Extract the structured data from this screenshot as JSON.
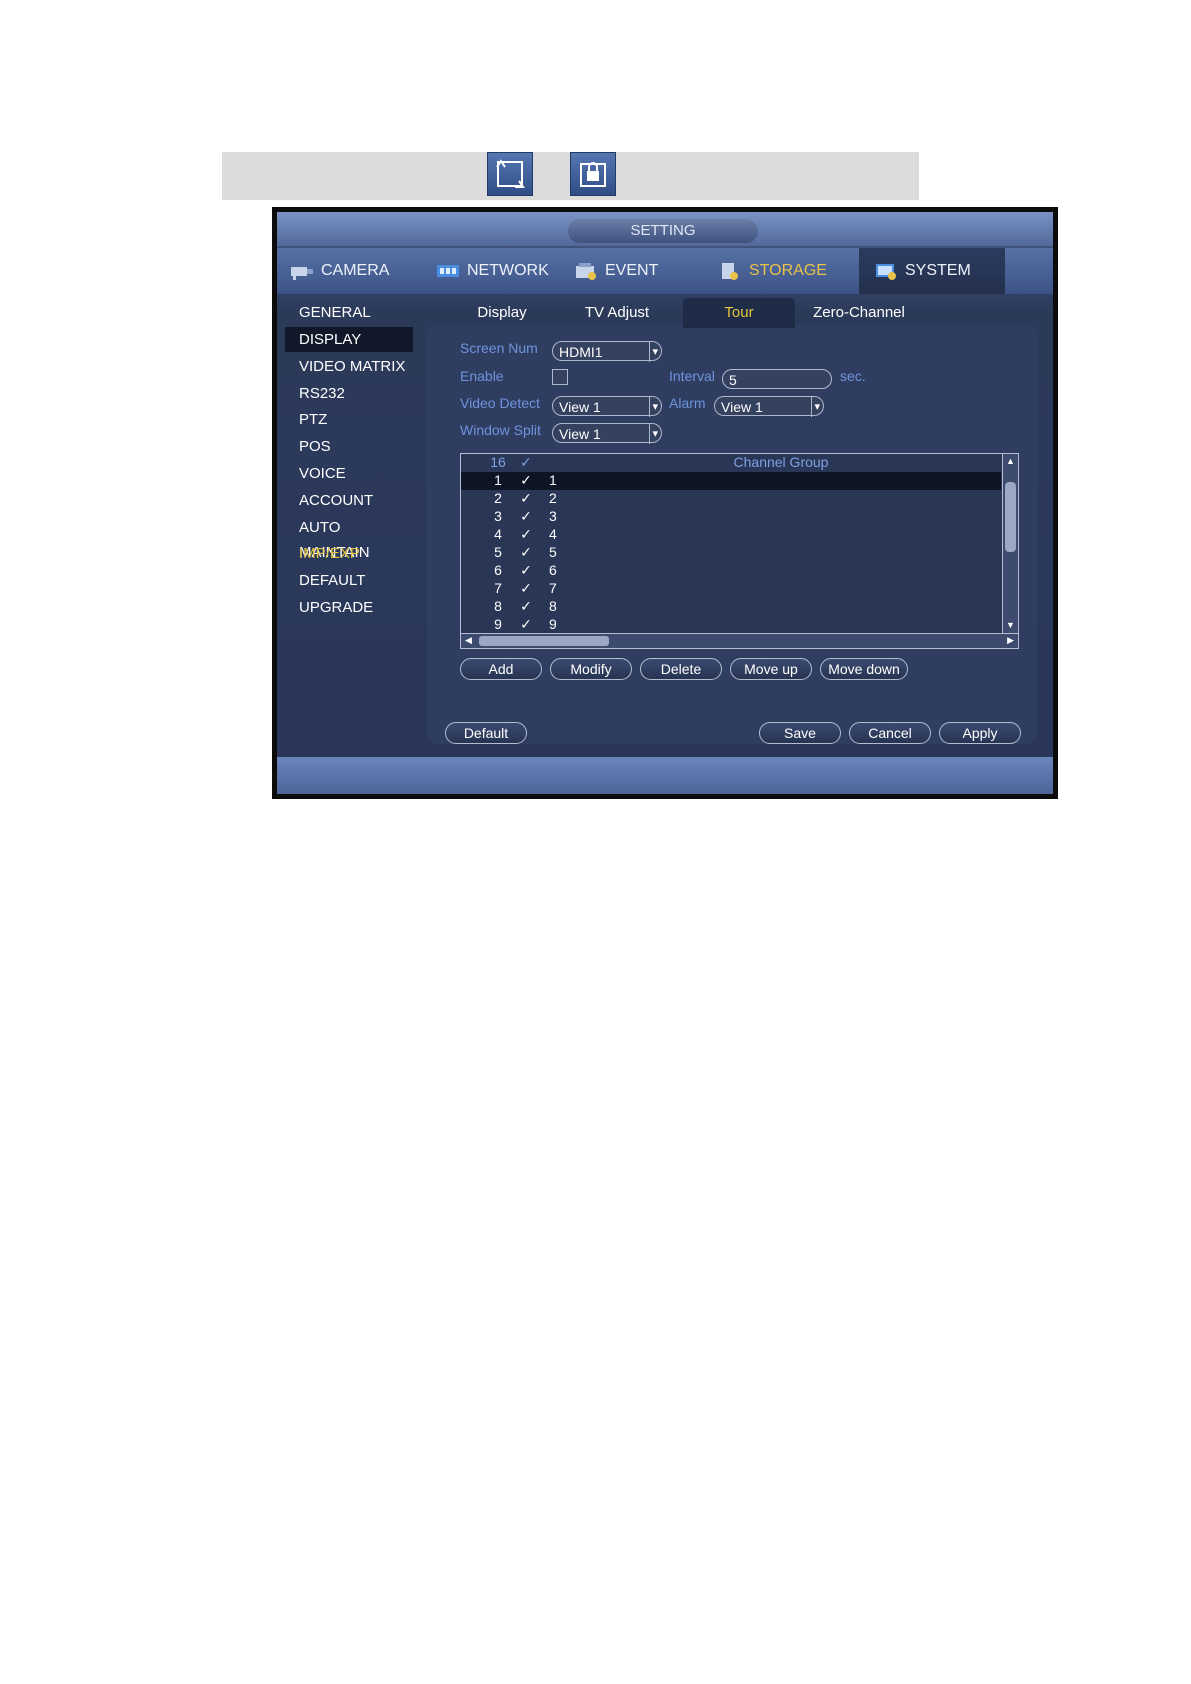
{
  "window": {
    "title": "SETTING"
  },
  "top_tabs": [
    {
      "label": "CAMERA",
      "icon": "camera-icon"
    },
    {
      "label": "NETWORK",
      "icon": "network-icon"
    },
    {
      "label": "EVENT",
      "icon": "event-icon"
    },
    {
      "label": "STORAGE",
      "icon": "storage-icon"
    },
    {
      "label": "SYSTEM",
      "icon": "system-icon"
    }
  ],
  "sidebar": {
    "items": [
      {
        "label": "GENERAL"
      },
      {
        "label": "DISPLAY"
      },
      {
        "label": "VIDEO MATRIX"
      },
      {
        "label": "RS232"
      },
      {
        "label": "PTZ"
      },
      {
        "label": "POS"
      },
      {
        "label": "VOICE"
      },
      {
        "label": "ACCOUNT"
      },
      {
        "label": "AUTO MAINTAIN"
      },
      {
        "label": "IMP/EXP"
      },
      {
        "label": "DEFAULT"
      },
      {
        "label": "UPGRADE"
      }
    ]
  },
  "sub_tabs": [
    {
      "label": "Display"
    },
    {
      "label": "TV Adjust"
    },
    {
      "label": "Tour"
    },
    {
      "label": "Zero-Channel"
    }
  ],
  "form": {
    "screen_num_label": "Screen Num",
    "screen_num_value": "HDMI1",
    "enable_label": "Enable",
    "interval_label": "Interval",
    "interval_value": "5",
    "interval_unit": "sec.",
    "video_detect_label": "Video Detect",
    "video_detect_value": "View 1",
    "alarm_label": "Alarm",
    "alarm_value": "View 1",
    "window_split_label": "Window Split",
    "window_split_value": "View 1"
  },
  "table": {
    "header": {
      "count": "16",
      "check": "✓",
      "group": "Channel Group"
    },
    "rows": [
      {
        "num": "1",
        "check": "✓",
        "group": "1"
      },
      {
        "num": "2",
        "check": "✓",
        "group": "2"
      },
      {
        "num": "3",
        "check": "✓",
        "group": "3"
      },
      {
        "num": "4",
        "check": "✓",
        "group": "4"
      },
      {
        "num": "5",
        "check": "✓",
        "group": "5"
      },
      {
        "num": "6",
        "check": "✓",
        "group": "6"
      },
      {
        "num": "7",
        "check": "✓",
        "group": "7"
      },
      {
        "num": "8",
        "check": "✓",
        "group": "8"
      },
      {
        "num": "9",
        "check": "✓",
        "group": "9"
      }
    ]
  },
  "table_buttons": {
    "add": "Add",
    "modify": "Modify",
    "delete": "Delete",
    "move_up": "Move up",
    "move_down": "Move down"
  },
  "footer_buttons": {
    "default": "Default",
    "save": "Save",
    "cancel": "Cancel",
    "apply": "Apply"
  },
  "colors": {
    "highlight": "#e2c43e",
    "label_blue": "#6f93dd",
    "panel": "#2f3e60"
  }
}
